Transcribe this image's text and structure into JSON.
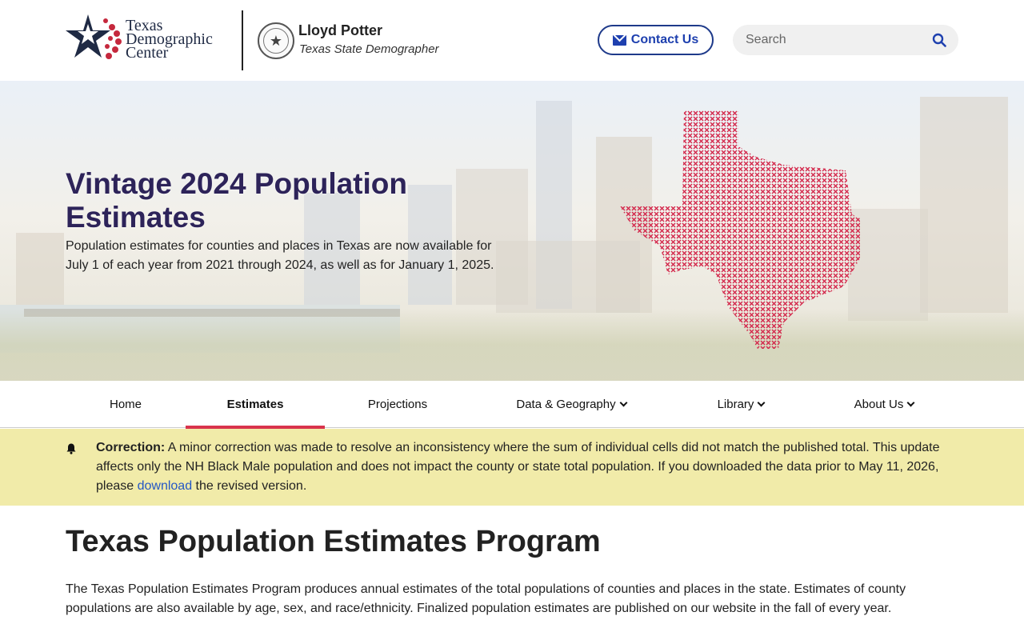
{
  "header": {
    "logo_lines": [
      "Texas",
      "Demographic",
      "Center"
    ],
    "official_name": "Lloyd Potter",
    "official_title": "Texas State Demographer",
    "contact_label": "Contact Us",
    "search_placeholder": "Search"
  },
  "hero": {
    "title": "Vintage 2024 Population Estimates",
    "description": "Population estimates for counties and places in Texas are now available for July 1 of each year from 2021 through 2024, as well as for January 1, 2025."
  },
  "nav": {
    "items": [
      {
        "label": "Home",
        "dropdown": false,
        "active": false
      },
      {
        "label": "Estimates",
        "dropdown": false,
        "active": true
      },
      {
        "label": "Projections",
        "dropdown": false,
        "active": false
      },
      {
        "label": "Data & Geography",
        "dropdown": true,
        "active": false
      },
      {
        "label": "Library",
        "dropdown": true,
        "active": false
      },
      {
        "label": "About Us",
        "dropdown": true,
        "active": false
      }
    ]
  },
  "notice": {
    "label": "Correction:",
    "text_before": " A minor correction was made to resolve an inconsistency where the sum of individual cells did not match the published total. This update affects only the NH Black Male population and does not impact the county or state total population. If you downloaded the data prior to May 11, 2026, please ",
    "link_text": "download",
    "text_after": " the revised version."
  },
  "main": {
    "title": "Texas Population Estimates Program",
    "intro": "The Texas Population Estimates Program produces annual estimates of the total populations of counties and places in the state. Estimates of county populations are also available by age, sex, and race/ethnicity. Finalized population estimates are published on our website in the fall of every year."
  },
  "colors": {
    "brand_navy": "#1f2a44",
    "hero_title": "#2d2359",
    "accent_red": "#d9344c",
    "link_blue": "#2457c5",
    "notice_bg": "#f1eba9"
  }
}
